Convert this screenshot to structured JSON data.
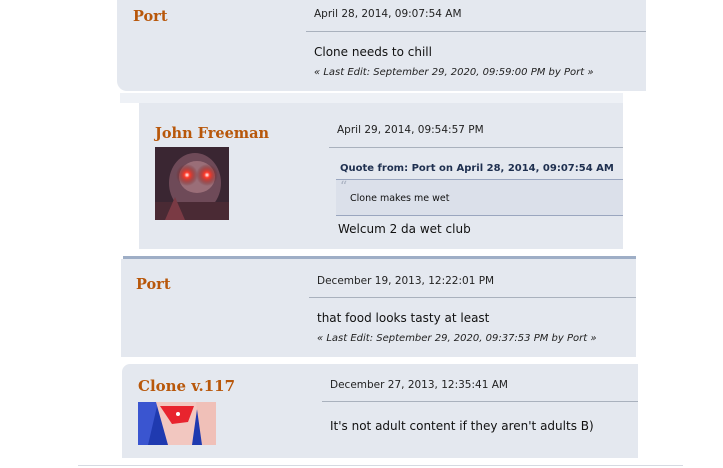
{
  "posts": [
    {
      "author": "Port",
      "date": "April 28, 2014, 09:07:54 AM",
      "body": "Clone needs to chill",
      "last_edit": "« Last Edit: September 29, 2020, 09:59:00 PM by Port »"
    },
    {
      "author": "John Freeman",
      "date": "April 29, 2014, 09:54:57 PM",
      "quote_header": "Quote from: Port on April 28, 2014, 09:07:54 AM",
      "quote_text": "Clone makes me wet",
      "body": "Welcum 2 da wet club"
    },
    {
      "author": "Port",
      "date": "December 19, 2013, 12:22:01 PM",
      "body": "that food looks tasty at least",
      "last_edit": "« Last Edit: September 29, 2020, 09:37:53 PM by Port »"
    },
    {
      "author": "Clone v.117",
      "date": "December 27, 2013, 12:35:41 AM",
      "body": "It's not adult content if they aren't adults B)"
    }
  ],
  "colors": {
    "post_bg": "#e4e8ef",
    "author": "#b8570a",
    "divider": "#a9b1bd",
    "separator": "#9eaec6"
  }
}
